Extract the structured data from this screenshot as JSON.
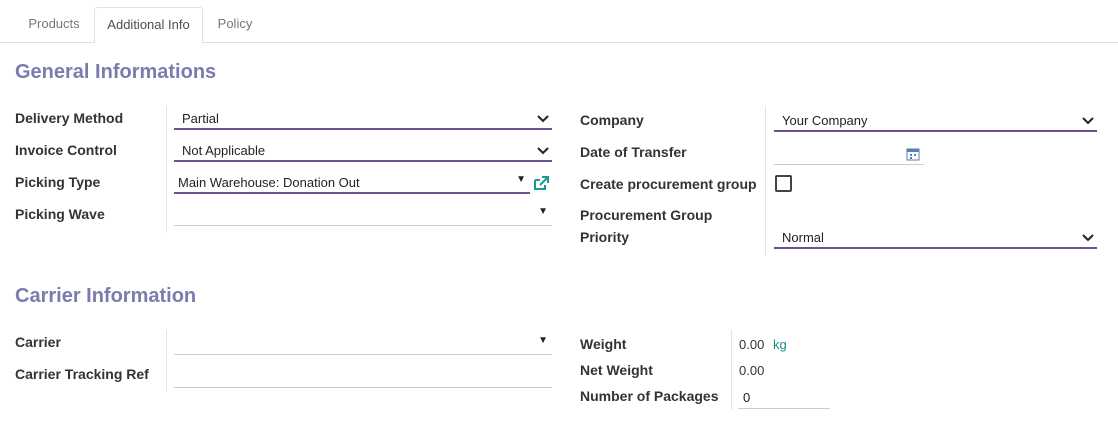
{
  "tabs": [
    {
      "label": "Products"
    },
    {
      "label": "Additional Info"
    },
    {
      "label": "Policy"
    }
  ],
  "general": {
    "title": "General Informations",
    "delivery_method_label": "Delivery Method",
    "delivery_method_value": "Partial",
    "invoice_control_label": "Invoice Control",
    "invoice_control_value": "Not Applicable",
    "picking_type_label": "Picking Type",
    "picking_type_value": "Main Warehouse: Donation Out",
    "picking_wave_label": "Picking Wave",
    "picking_wave_value": "",
    "company_label": "Company",
    "company_value": "Your Company",
    "date_of_transfer_label": "Date of Transfer",
    "date_of_transfer_value": "",
    "create_procurement_group_label": "Create procurement group",
    "create_procurement_group_checked": false,
    "procurement_group_label": "Procurement Group",
    "priority_label": "Priority",
    "priority_value": "Normal"
  },
  "carrier": {
    "title": "Carrier Information",
    "carrier_label": "Carrier",
    "carrier_value": "",
    "tracking_ref_label": "Carrier Tracking Ref",
    "tracking_ref_value": "",
    "weight_label": "Weight",
    "weight_value": "0.00",
    "weight_unit": "kg",
    "net_weight_label": "Net Weight",
    "net_weight_value": "0.00",
    "packages_label": "Number of Packages",
    "packages_value": "0"
  },
  "icons": {
    "dropdown": "chevron-down-icon",
    "select_caret": "caret-down-icon",
    "external_link": "external-link-icon",
    "calendar": "calendar-icon"
  },
  "colors": {
    "section_title": "#7c7bad",
    "focus_underline": "#6b4f8f",
    "unit_text": "#1a8c8c",
    "external_link": "#1a9a8a"
  }
}
